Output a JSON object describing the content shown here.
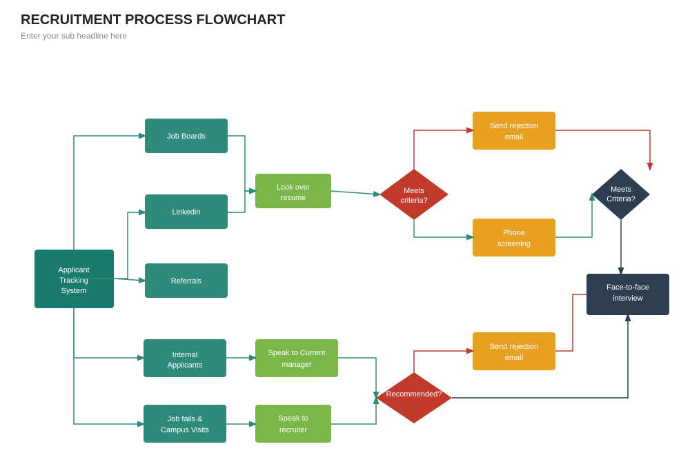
{
  "title": "RECRUITMENT PROCESS FLOWCHART",
  "subtitle": "Enter your sub headline here",
  "nodes": {
    "ats": "Applicant\nTracking\nSystem",
    "job_boards": "Job Boards",
    "linkedin": "Linkedin",
    "referrals": "Referrals",
    "internal": "Internal\nApplicants",
    "job_fails": "Job fails &\nCampus Visits",
    "look_over": "Look over\nresume",
    "speak_current": "Speak to Current\nmanager",
    "speak_recruiter": "Speak to\nrecruiter",
    "meets_criteria": "Meets\ncriteria?",
    "recommended": "Recommended?",
    "meets_criteria2": "Meets\nCriteria?",
    "send_rejection1": "Send rejection\nemail",
    "phone_screening": "Phone\nscreening",
    "send_rejection2": "Send rejection\nemail",
    "face_interview": "Face-to-face\ninterview"
  }
}
